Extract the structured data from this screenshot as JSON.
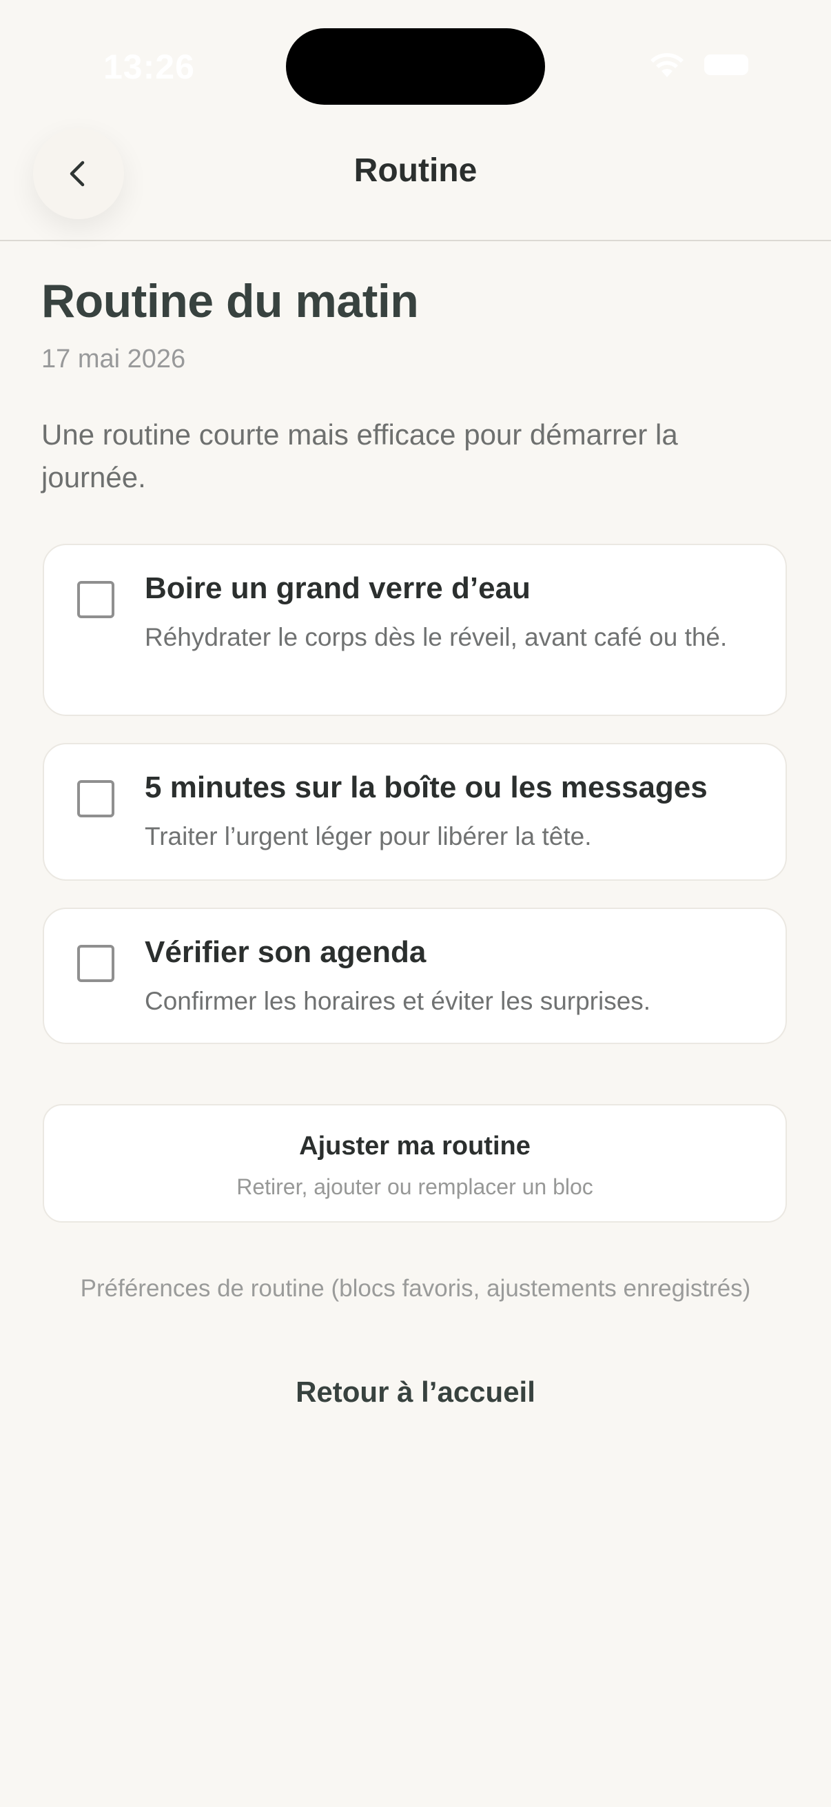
{
  "status_bar": {
    "time": "13:26",
    "icons": [
      "wifi-icon",
      "battery-icon"
    ]
  },
  "header": {
    "back_icon": "chevron-left-icon",
    "title": "Routine"
  },
  "main": {
    "title": "Routine du matin",
    "date": "17 mai 2026",
    "intro": "Une routine courte mais efficace pour démarrer la journée.",
    "tasks": [
      {
        "title": "Boire un grand verre d’eau",
        "description": "Réhydrater le corps dès le réveil, avant café ou thé.",
        "checked": false
      },
      {
        "title": "5 minutes sur la boîte ou les messages",
        "description": "Traiter l’urgent léger pour libérer la tête.",
        "checked": false
      },
      {
        "title": "Vérifier son agenda",
        "description": "Confirmer les horaires et éviter les surprises.",
        "checked": false
      }
    ],
    "adjust_button": {
      "title": "Ajuster ma routine",
      "subtitle": "Retirer, ajouter ou remplacer un bloc"
    },
    "preferences_link": "Préférences de routine (blocs favoris, ajustements enregistrés)",
    "home_link": "Retour à l’accueil"
  },
  "colors": {
    "background": "#f9f7f3",
    "card": "#ffffff",
    "title": "#38423f",
    "text": "#2b2f2e",
    "muted": "#98999a"
  }
}
